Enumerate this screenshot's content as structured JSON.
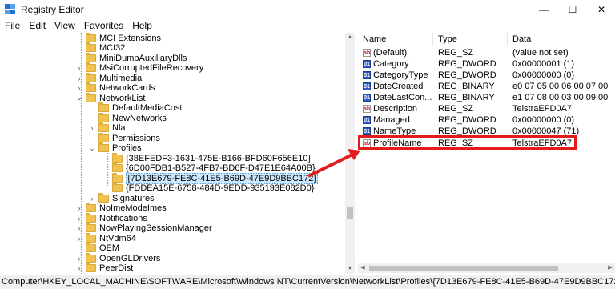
{
  "window": {
    "title": "Registry Editor",
    "controls": {
      "minimize": "—",
      "maximize": "☐",
      "close": "✕"
    }
  },
  "menu": [
    "File",
    "Edit",
    "View",
    "Favorites",
    "Help"
  ],
  "tree": [
    {
      "label": "MCI Extensions",
      "arrow": ""
    },
    {
      "label": "MCI32",
      "arrow": ""
    },
    {
      "label": "MiniDumpAuxiliaryDlls",
      "arrow": ""
    },
    {
      "label": "MsiCorruptedFileRecovery",
      "arrow": "›"
    },
    {
      "label": "Multimedia",
      "arrow": "›"
    },
    {
      "label": "NetworkCards",
      "arrow": "›"
    },
    {
      "label": "NetworkList",
      "arrow": "⌄"
    },
    {
      "label": "DefaultMediaCost",
      "arrow": ""
    },
    {
      "label": "NewNetworks",
      "arrow": ""
    },
    {
      "label": "Nla",
      "arrow": "›"
    },
    {
      "label": "Permissions",
      "arrow": ""
    },
    {
      "label": "Profiles",
      "arrow": "⌄"
    },
    {
      "label": "{38EFEDF3-1631-475E-B166-BFD60F656E10}",
      "arrow": ""
    },
    {
      "label": "{6D00FDB1-B527-4FB7-BD6F-D47E1E64A00B}",
      "arrow": ""
    },
    {
      "label": "{7D13E679-FE8C-41E5-B69D-47E9D9BBC172}",
      "arrow": ""
    },
    {
      "label": "{FDDEA15E-6758-484D-9EDD-935193E082D0}",
      "arrow": ""
    },
    {
      "label": "Signatures",
      "arrow": "›"
    },
    {
      "label": "NoImeModeImes",
      "arrow": "›"
    },
    {
      "label": "Notifications",
      "arrow": "›"
    },
    {
      "label": "NowPlayingSessionManager",
      "arrow": "›"
    },
    {
      "label": "NtVdm64",
      "arrow": "›"
    },
    {
      "label": "OEM",
      "arrow": ""
    },
    {
      "label": "OpenGLDrivers",
      "arrow": "›"
    },
    {
      "label": "PeerDist",
      "arrow": "›"
    }
  ],
  "list": {
    "headers": {
      "name": "Name",
      "type": "Type",
      "data": "Data"
    },
    "rows": [
      {
        "name": "(Default)",
        "type": "REG_SZ",
        "data": "(value not set)",
        "icon": "ab"
      },
      {
        "name": "Category",
        "type": "REG_DWORD",
        "data": "0x00000001 (1)",
        "icon": "bin"
      },
      {
        "name": "CategoryType",
        "type": "REG_DWORD",
        "data": "0x00000000 (0)",
        "icon": "bin"
      },
      {
        "name": "DateCreated",
        "type": "REG_BINARY",
        "data": "e0 07 05 00 06 00 07 00",
        "icon": "bin"
      },
      {
        "name": "DateLastCon...",
        "type": "REG_BINARY",
        "data": "e1 07 08 00 03 00 09 00",
        "icon": "bin"
      },
      {
        "name": "Description",
        "type": "REG_SZ",
        "data": "TelstraEFD0A7",
        "icon": "ab"
      },
      {
        "name": "Managed",
        "type": "REG_DWORD",
        "data": "0x00000000 (0)",
        "icon": "bin"
      },
      {
        "name": "NameType",
        "type": "REG_DWORD",
        "data": "0x00000047 (71)",
        "icon": "bin"
      },
      {
        "name": "ProfileName",
        "type": "REG_SZ",
        "data": "TelstraEFD0A7",
        "icon": "ab"
      }
    ]
  },
  "status": "Computer\\HKEY_LOCAL_MACHINE\\SOFTWARE\\Microsoft\\Windows NT\\CurrentVersion\\NetworkList\\Profiles\\{7D13E679-FE8C-41E5-B69D-47E9D9BBC172}",
  "colors": {
    "highlight": "#e21b1b",
    "selection": "#cce8ff"
  }
}
